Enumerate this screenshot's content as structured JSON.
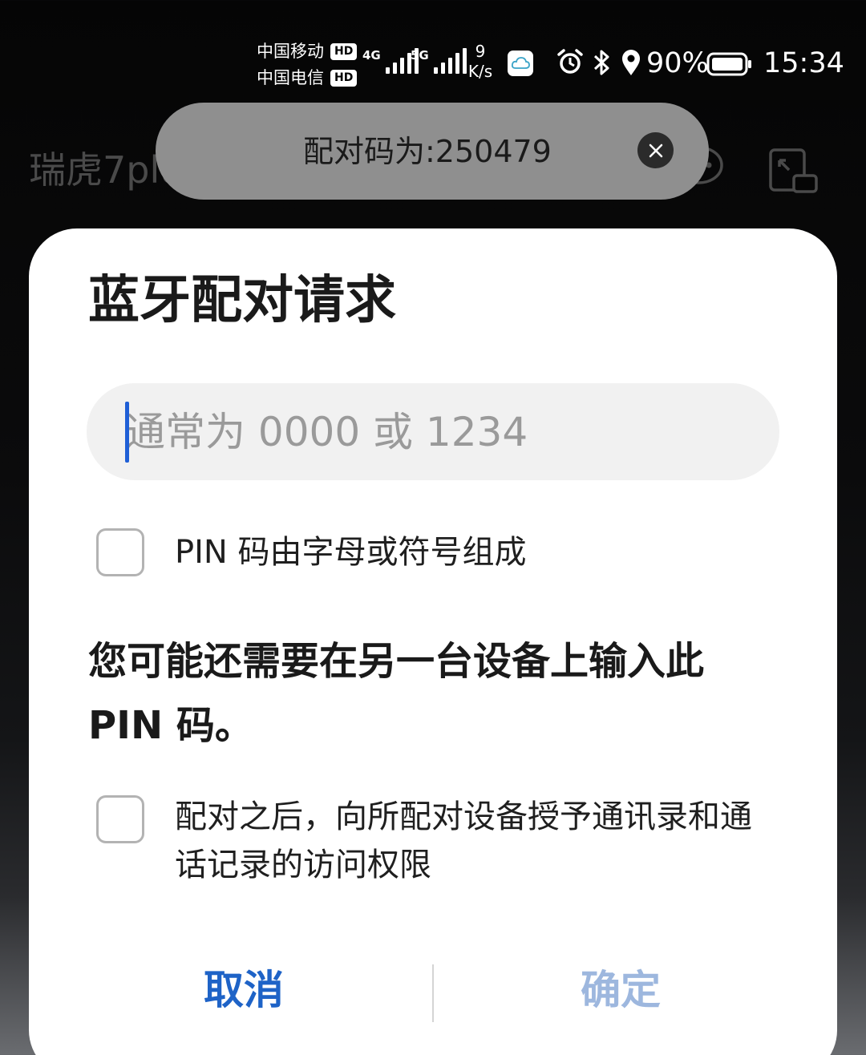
{
  "status_bar": {
    "carrier_1": "中国移动",
    "carrier_2": "中国电信",
    "hd_label": "HD",
    "signal_1_gen": "4G",
    "signal_2_gen": "5G",
    "net_speed_value": "9",
    "net_speed_unit": "K/s",
    "battery": "90%",
    "time": "15:34",
    "icons": [
      "cloud-app-icon",
      "alarm-icon",
      "bluetooth-icon",
      "location-icon",
      "battery-icon"
    ]
  },
  "app": {
    "title": "瑞虎7plus",
    "icons": [
      "chat-icon",
      "cast-icon"
    ]
  },
  "toast": {
    "text": "配对码为:250479"
  },
  "dialog": {
    "title": "蓝牙配对请求",
    "pin_placeholder": "通常为 0000 或 1234",
    "pin_value": "",
    "checkbox_alnum_label": "PIN 码由字母或符号组成",
    "checkbox_alnum_checked": false,
    "info": "您可能还需要在另一台设备上输入此 PIN 码。",
    "checkbox_contacts_label": "配对之后，向所配对设备授予通讯录和通话记录的访问权限",
    "checkbox_contacts_checked": false,
    "cancel_label": "取消",
    "ok_label": "确定",
    "colors": {
      "primary": "#1e63c7",
      "disabled": "#9db7de"
    }
  }
}
